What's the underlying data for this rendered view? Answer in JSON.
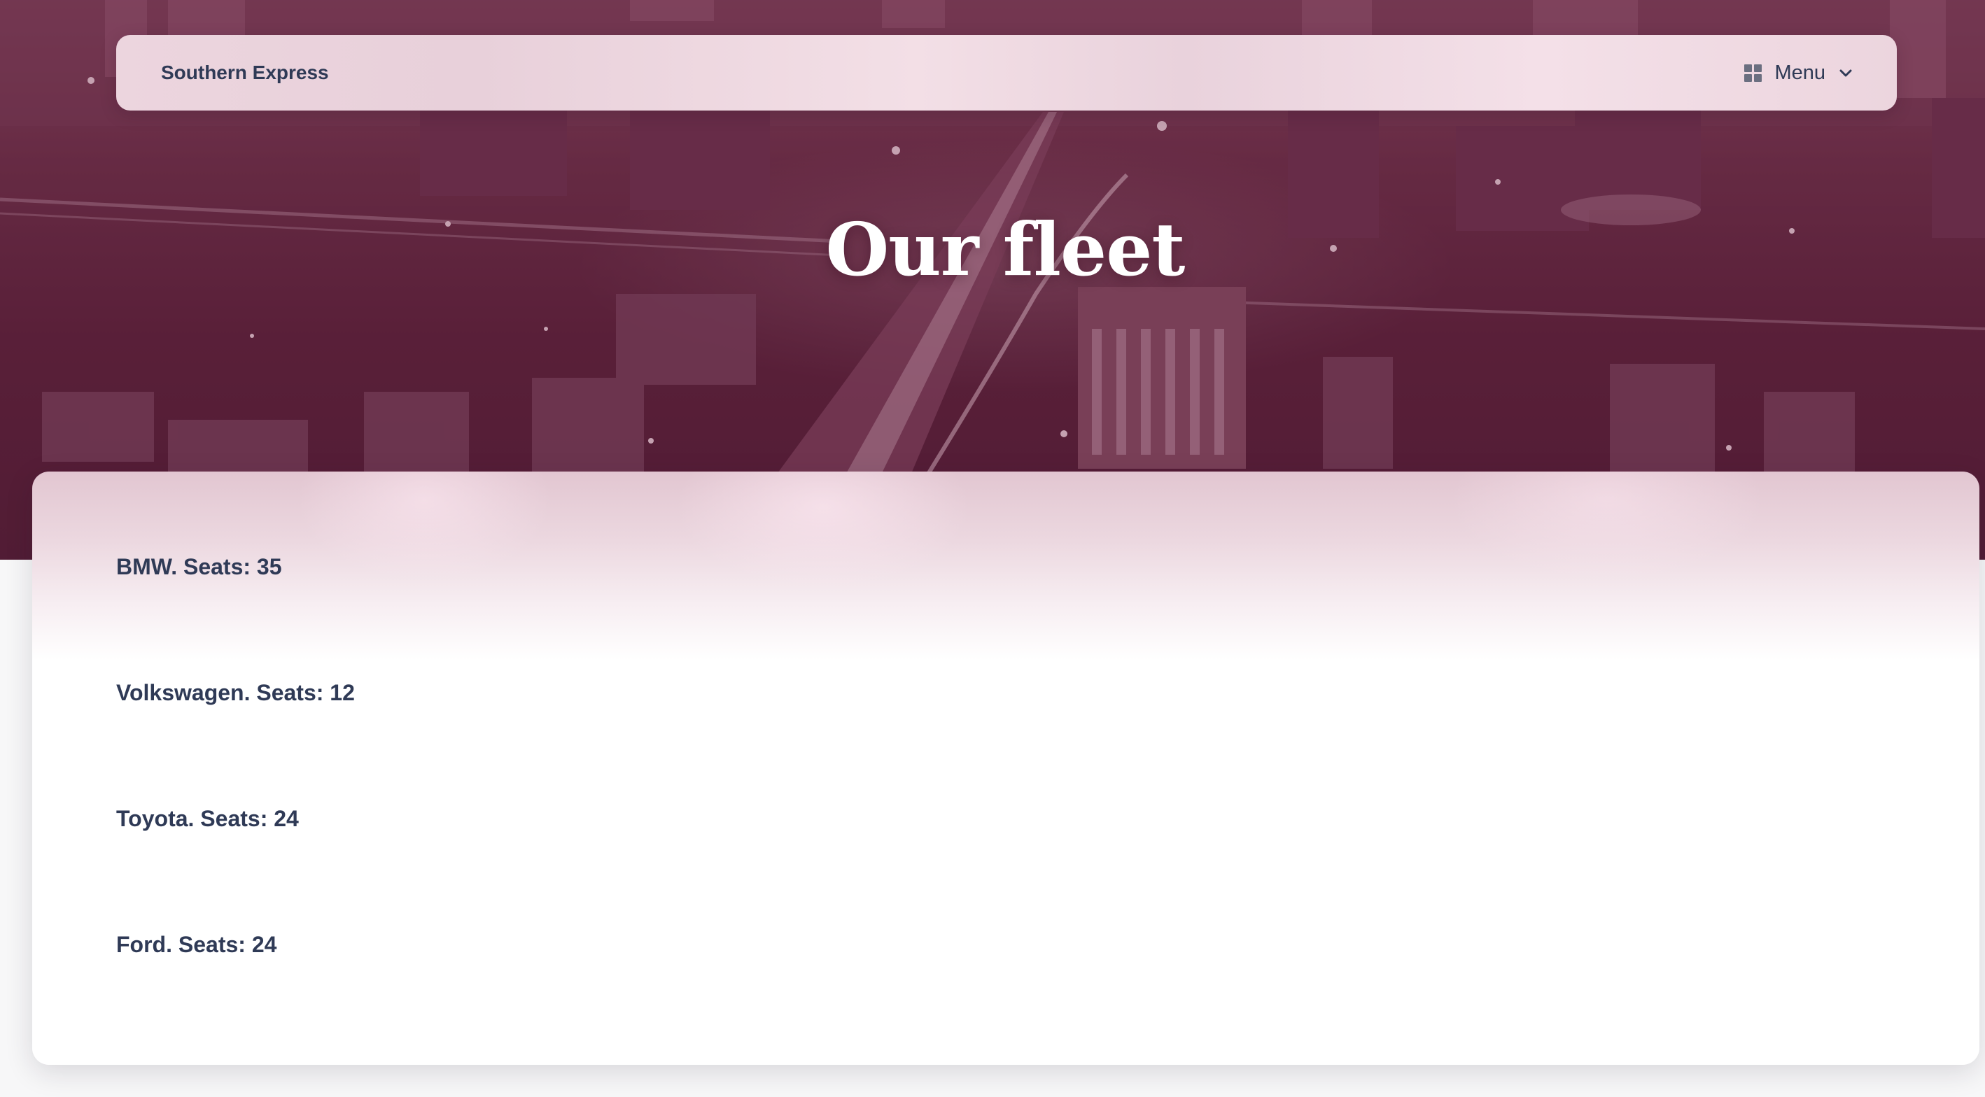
{
  "site": {
    "brand": "Southern Express"
  },
  "nav": {
    "menu_label": "Menu"
  },
  "hero": {
    "title": "Our fleet"
  },
  "fleet": {
    "items": [
      "BMW. Seats: 35",
      "Volkswagen. Seats: 12",
      "Toyota. Seats: 24",
      "Ford. Seats: 24"
    ]
  },
  "colors": {
    "hero_tint": "#5a2039",
    "header_bg": "#ecd5de",
    "text": "#2f3a56",
    "hero_text": "#ffffff"
  },
  "icons": {
    "menu_grid": "dashboard-grid-icon",
    "menu_chevron": "chevron-down-icon"
  }
}
